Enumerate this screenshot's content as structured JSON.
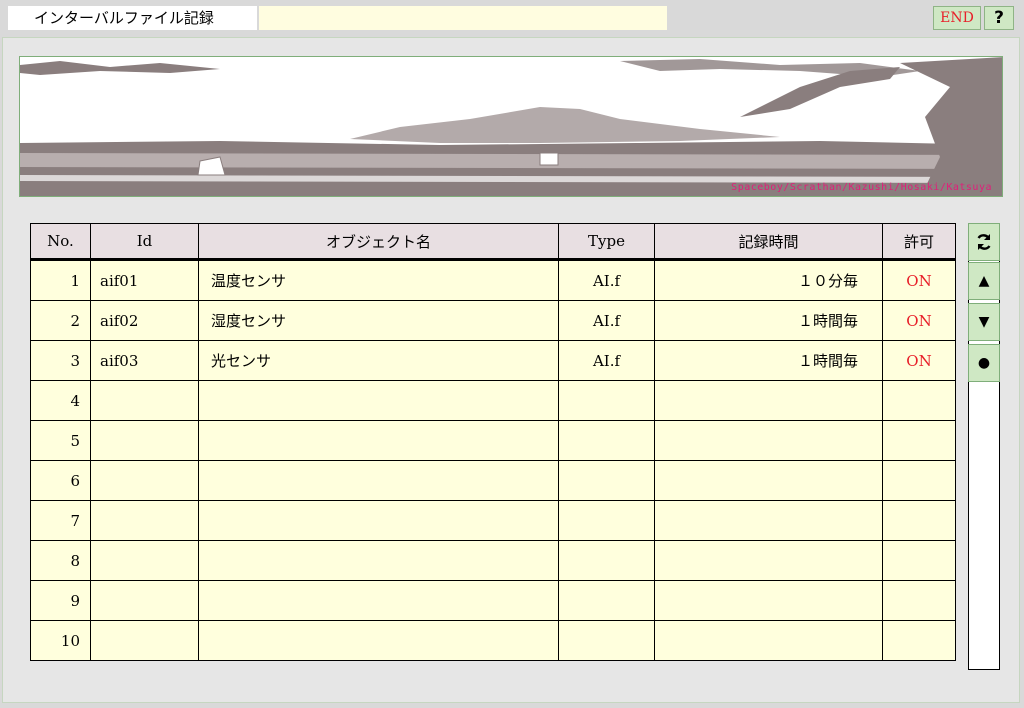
{
  "window": {
    "title": "インターバルファイル記録",
    "title_field_value": ""
  },
  "toolbar": {
    "end_label": "END",
    "help_label": "?"
  },
  "banner": {
    "credit": "Spaceboy/Scrathan/Kazushi/Hosaki/Katsuya"
  },
  "table": {
    "headers": {
      "no": "No.",
      "id": "Id",
      "name": "オブジェクト名",
      "type": "Type",
      "time": "記録時間",
      "perm": "許可"
    },
    "rows": [
      {
        "no": "1",
        "id": "aif01",
        "name": "温度センサ",
        "type": "AI.f",
        "time": "１０分毎",
        "perm": "ON"
      },
      {
        "no": "2",
        "id": "aif02",
        "name": "湿度センサ",
        "type": "AI.f",
        "time": "１時間毎",
        "perm": "ON"
      },
      {
        "no": "3",
        "id": "aif03",
        "name": "光センサ",
        "type": "AI.f",
        "time": "１時間毎",
        "perm": "ON"
      },
      {
        "no": "4",
        "id": "",
        "name": "",
        "type": "",
        "time": "",
        "perm": ""
      },
      {
        "no": "5",
        "id": "",
        "name": "",
        "type": "",
        "time": "",
        "perm": ""
      },
      {
        "no": "6",
        "id": "",
        "name": "",
        "type": "",
        "time": "",
        "perm": ""
      },
      {
        "no": "7",
        "id": "",
        "name": "",
        "type": "",
        "time": "",
        "perm": ""
      },
      {
        "no": "8",
        "id": "",
        "name": "",
        "type": "",
        "time": "",
        "perm": ""
      },
      {
        "no": "9",
        "id": "",
        "name": "",
        "type": "",
        "time": "",
        "perm": ""
      },
      {
        "no": "10",
        "id": "",
        "name": "",
        "type": "",
        "time": "",
        "perm": ""
      }
    ]
  },
  "side_controls": {
    "refresh_icon": "refresh-icon",
    "up_icon": "▲",
    "down_icon": "▼",
    "select_icon": "●"
  },
  "colors": {
    "on_text": "#e8202a",
    "button_bg": "#cfe8c4",
    "cell_bg": "#ffffdd",
    "header_bg": "#e8dfe2"
  }
}
